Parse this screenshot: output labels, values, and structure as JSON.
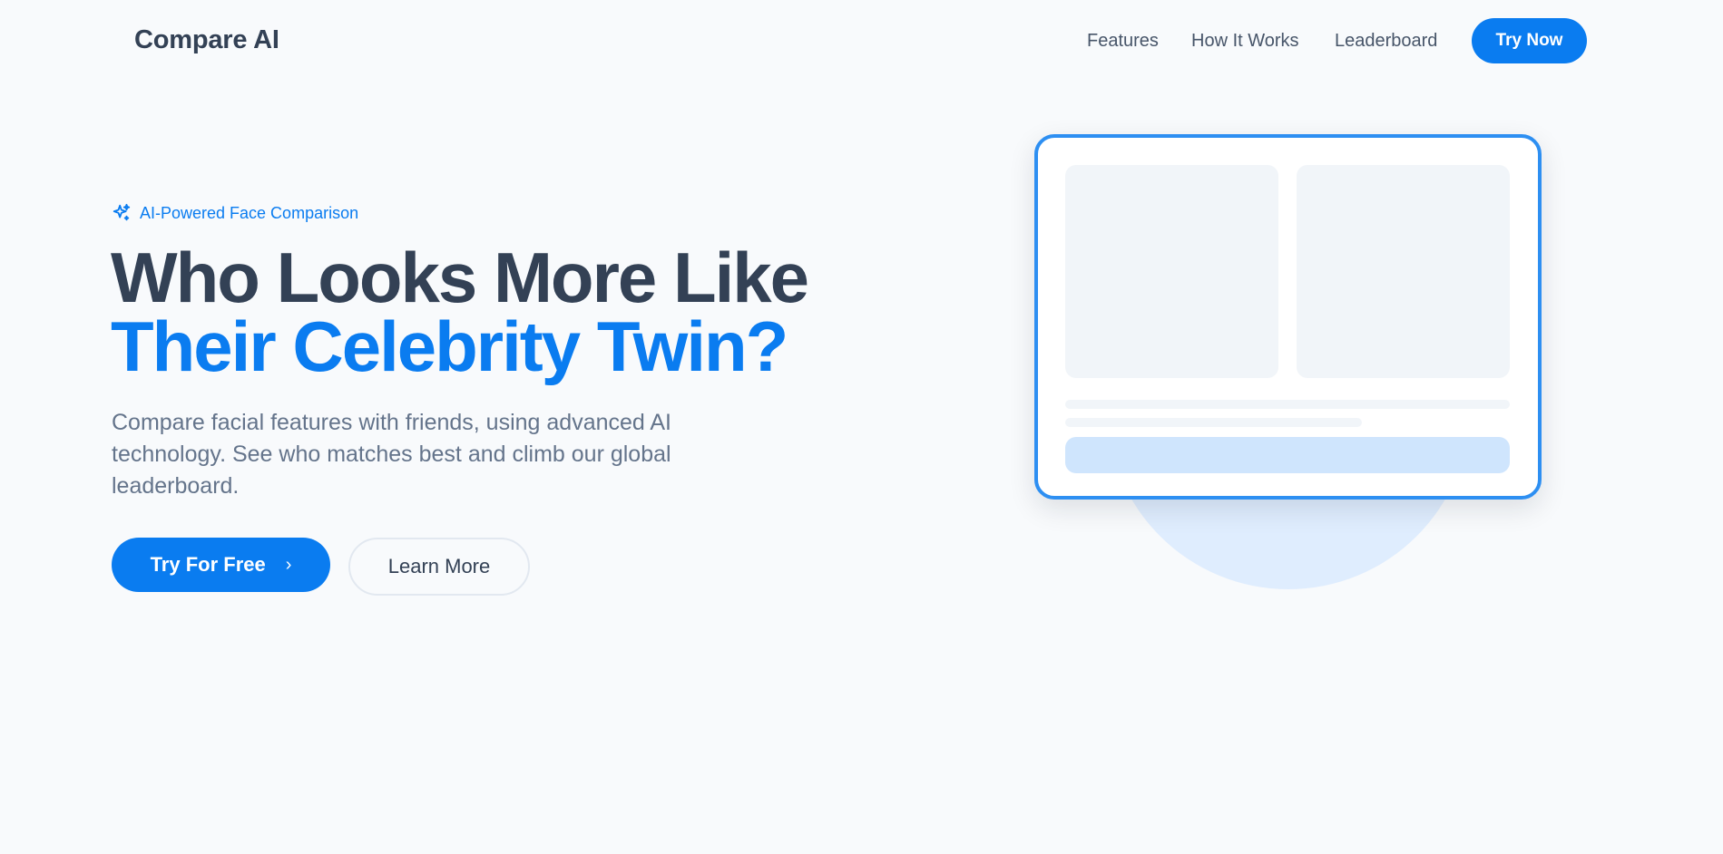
{
  "header": {
    "logo": "Compare AI",
    "nav": [
      "Features",
      "How It Works",
      "Leaderboard"
    ],
    "cta": "Try Now"
  },
  "hero": {
    "badge_icon": "sparkles-icon",
    "badge": "AI-Powered Face Comparison",
    "title_line1": "Who Looks More Like",
    "title_line2": "Their Celebrity Twin?",
    "description": "Compare facial features with friends, using advanced AI technology. See who matches best and climb our global leaderboard.",
    "primary_button": "Try For Free",
    "primary_button_icon": "chevron-right-icon",
    "secondary_button": "Learn More"
  },
  "colors": {
    "accent": "#0a7cf0",
    "heading": "#334155",
    "body_text": "#64748b",
    "background": "#f8fafc"
  }
}
